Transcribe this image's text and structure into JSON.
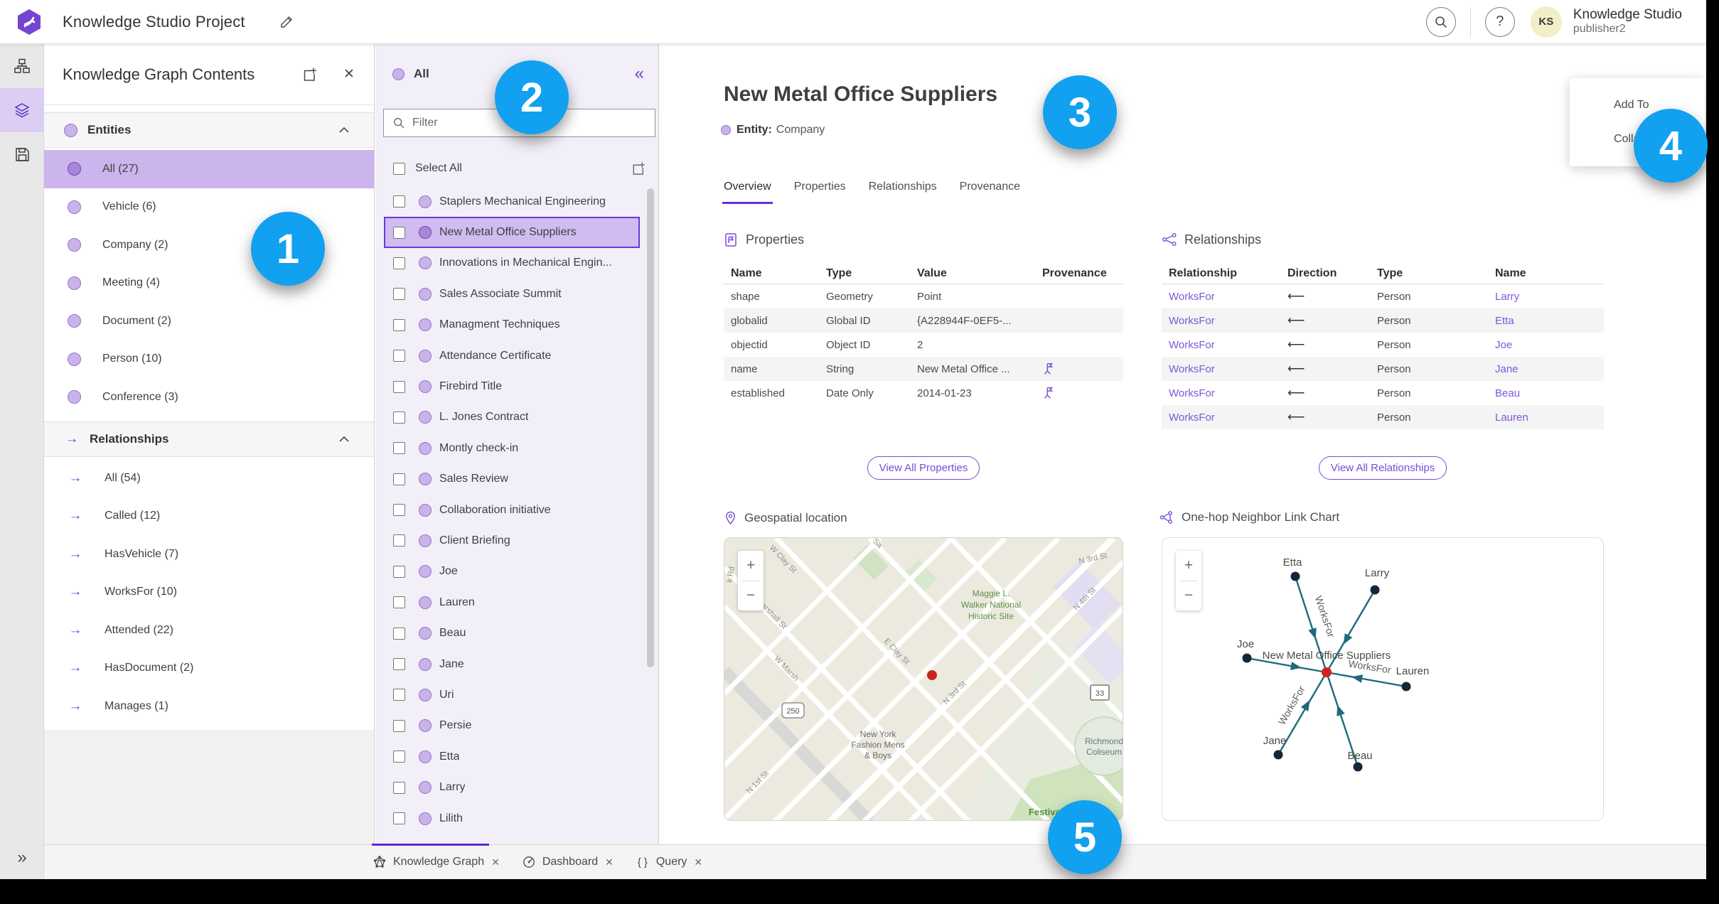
{
  "topbar": {
    "title": "Knowledge Studio Project",
    "user": {
      "initials": "KS",
      "name": "Knowledge Studio",
      "role": "publisher2"
    }
  },
  "icons": {
    "help_glyph": "?",
    "close_glyph": "✕",
    "collapse_left_glyph": "«",
    "expand_right_glyph": "»",
    "relationship_arrow": "→"
  },
  "contents_panel": {
    "title": "Knowledge Graph Contents",
    "entities": {
      "label": "Entities",
      "selected_index": 0,
      "items": [
        "All (27)",
        "Vehicle (6)",
        "Company (2)",
        "Meeting (4)",
        "Document (2)",
        "Person (10)",
        "Conference (3)"
      ]
    },
    "relationships": {
      "label": "Relationships",
      "selected_index": -1,
      "items": [
        "All (54)",
        "Called (12)",
        "HasVehicle (7)",
        "WorksFor (10)",
        "Attended (22)",
        "HasDocument (2)",
        "Manages (1)"
      ]
    }
  },
  "list_panel": {
    "header": "All",
    "filter_placeholder": "Filter",
    "select_all_label": "Select All",
    "selected_index": 1,
    "items": [
      "Staplers Mechanical Engineering",
      "New Metal Office Suppliers",
      "Innovations in Mechanical Engin...",
      "Sales Associate Summit",
      "Managment Techniques",
      "Attendance Certificate",
      "Firebird Title",
      "L. Jones Contract",
      "Montly check-in",
      "Sales Review",
      "Collaboration initiative",
      "Client Briefing",
      "Joe",
      "Lauren",
      "Beau",
      "Jane",
      "Uri",
      "Persie",
      "Etta",
      "Larry",
      "Lilith"
    ]
  },
  "main": {
    "title": "New Metal Office Suppliers",
    "entity_label": "Entity:",
    "entity_type": "Company",
    "active_tab_index": 0,
    "tabs": [
      "Overview",
      "Properties",
      "Relationships",
      "Provenance"
    ],
    "properties": {
      "heading": "Properties",
      "columns": [
        "Name",
        "Type",
        "Value",
        "Provenance"
      ],
      "rows": [
        {
          "name": "shape",
          "type": "Geometry",
          "value": "Point",
          "provenance": false
        },
        {
          "name": "globalid",
          "type": "Global ID",
          "value": "{A228944F-0EF5-...",
          "provenance": false
        },
        {
          "name": "objectid",
          "type": "Object ID",
          "value": "2",
          "provenance": false
        },
        {
          "name": "name",
          "type": "String",
          "value": "New Metal Office ...",
          "provenance": true
        },
        {
          "name": "established",
          "type": "Date Only",
          "value": "2014-01-23",
          "provenance": true
        }
      ],
      "view_all_label": "View All Properties"
    },
    "relationships": {
      "heading": "Relationships",
      "columns": [
        "Relationship",
        "Direction",
        "Type",
        "Name"
      ],
      "rows": [
        {
          "relationship": "WorksFor",
          "direction": "⟵",
          "type": "Person",
          "name": "Larry"
        },
        {
          "relationship": "WorksFor",
          "direction": "⟵",
          "type": "Person",
          "name": "Etta"
        },
        {
          "relationship": "WorksFor",
          "direction": "⟵",
          "type": "Person",
          "name": "Joe"
        },
        {
          "relationship": "WorksFor",
          "direction": "⟵",
          "type": "Person",
          "name": "Jane"
        },
        {
          "relationship": "WorksFor",
          "direction": "⟵",
          "type": "Person",
          "name": "Beau"
        },
        {
          "relationship": "WorksFor",
          "direction": "⟵",
          "type": "Person",
          "name": "Lauren"
        }
      ],
      "view_all_label": "View All Relationships"
    },
    "map": {
      "heading": "Geospatial location",
      "zoom_in": "+",
      "zoom_out": "−",
      "labels": {
        "k_rd": "k Rd",
        "w_clay_st": "W Clay St",
        "sa": "Sa",
        "n_3rd_st_top": "N 3rd St",
        "maggie_1": "Maggie L.",
        "maggie_2": "Walker National",
        "maggie_3": "Historic Site",
        "n_4th_st": "N 4th St",
        "marshall_st": "arshall St",
        "e_clay_st": "E Clay St",
        "w_marshall": "W Marsh",
        "route_250": "250",
        "nyf_1": "New York",
        "nyf_2": "Fashion Mens",
        "nyf_3": "& Boys",
        "n_3rd_st_mid": "N 3rd St",
        "route_33": "33",
        "coliseum_1": "Richmond",
        "coliseum_2": "Coliseum",
        "festival_park": "Festival Park",
        "n_1st_st": "N 1st St"
      }
    },
    "link_chart": {
      "heading": "One-hop Neighbor Link Chart",
      "zoom_in": "+",
      "zoom_out": "−",
      "center_label": "New Metal Office Suppliers",
      "edge_label": "WorksFor",
      "nodes": [
        "Etta",
        "Larry",
        "Joe",
        "Lauren",
        "Jane",
        "Beau"
      ]
    }
  },
  "overflow_card": {
    "items": [
      {
        "label": "Add To"
      },
      {
        "label": "Colla"
      }
    ]
  },
  "bottom_tabs": [
    {
      "label": "Knowledge Graph"
    },
    {
      "label": "Dashboard"
    },
    {
      "label": "Query"
    }
  ],
  "callouts": [
    {
      "n": "1"
    },
    {
      "n": "2"
    },
    {
      "n": "3"
    },
    {
      "n": "4"
    },
    {
      "n": "5"
    }
  ]
}
